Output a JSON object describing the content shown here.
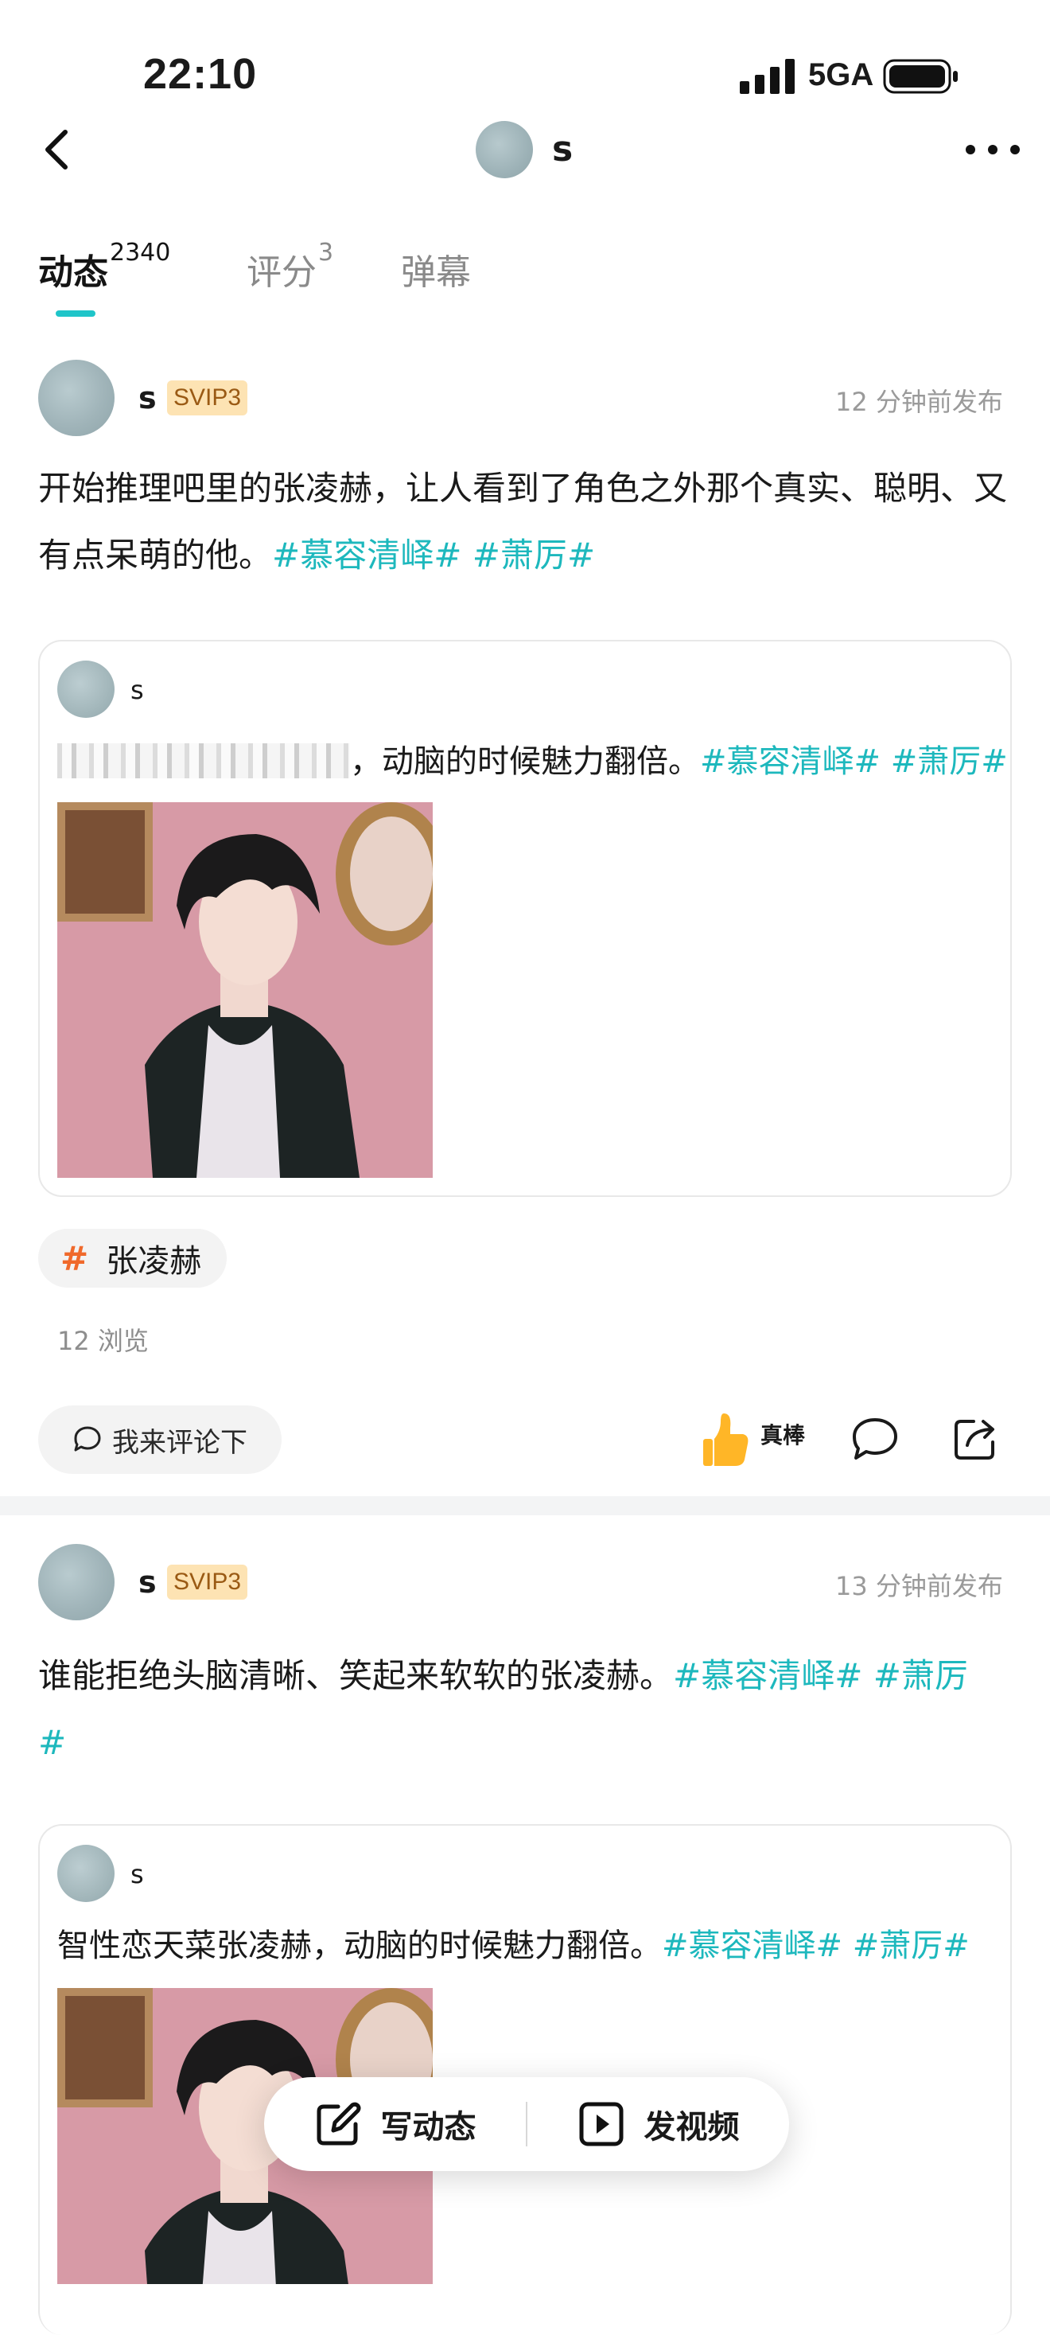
{
  "status_bar": {
    "time": "22:10",
    "network": "5GA"
  },
  "nav": {
    "title": "s"
  },
  "tabs": [
    {
      "label": "动态",
      "count": "2340"
    },
    {
      "label": "评分",
      "count": "3"
    },
    {
      "label": "弹幕",
      "count": ""
    }
  ],
  "posts": [
    {
      "author": "s",
      "badge": "SVIP3",
      "time": "12 分钟前发布",
      "text": "开始推理吧里的张凌赫，让人看到了角色之外那个真实、聪明、又有点呆萌的他。",
      "hashtags": [
        "#慕容清峄#",
        "#萧厉#"
      ],
      "quote": {
        "author": "s",
        "text_visible": "，动脑的时候魅力翻倍。",
        "hashtags": [
          "#慕容清峄#",
          "#萧厉#"
        ]
      },
      "topic": "张凌赫",
      "topic_icon": "#",
      "views": "12 浏览",
      "comment_placeholder": "我来评论下",
      "like_label": "真棒"
    },
    {
      "author": "s",
      "badge": "SVIP3",
      "time": "13 分钟前发布",
      "text": "谁能拒绝头脑清晰、笑起来软软的张凌赫。",
      "hashtags": [
        "#慕容清峄#",
        "#萧厉",
        "#"
      ],
      "quote": {
        "author": "s",
        "text": "智性恋天菜张凌赫，动脑的时候魅力翻倍。",
        "hashtags": [
          "#慕容清峄#",
          "#萧厉#"
        ]
      }
    }
  ],
  "fab": {
    "write_label": "写动态",
    "video_label": "发视频"
  },
  "colors": {
    "accent": "#1fc5c9",
    "hashtag": "#1db8bd",
    "vip_bg": "#fde3b3",
    "topic_hash": "#f0692b"
  },
  "icons": [
    "back-icon",
    "more-icon",
    "comment-icon",
    "thumbs-up-icon",
    "share-icon",
    "edit-icon",
    "video-icon"
  ]
}
